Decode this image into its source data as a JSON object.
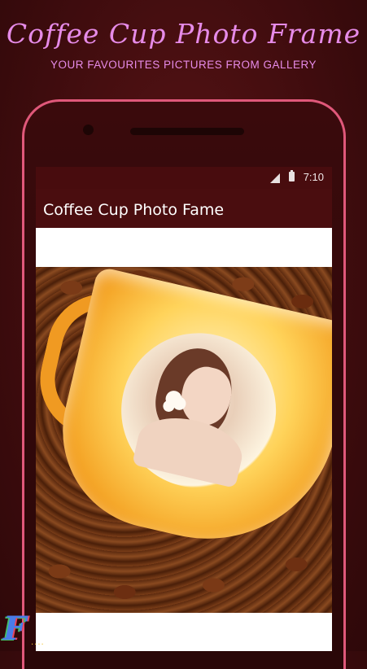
{
  "promo": {
    "title": "Coffee Cup Photo Frame",
    "subtitle": "YOUR FAVOURITES PICTURES FROM GALLERY"
  },
  "statusbar": {
    "time": "7:10",
    "icons": [
      "signal-icon",
      "battery-icon"
    ]
  },
  "app": {
    "title": "Coffee Cup Photo Fame"
  },
  "logo": {
    "letter": "F",
    "dots": "...."
  },
  "colors": {
    "background": "#4a0d0f",
    "promo_text": "#e68be8",
    "phone_outline": "#e0587a",
    "appbar": "#4a0d0f"
  }
}
